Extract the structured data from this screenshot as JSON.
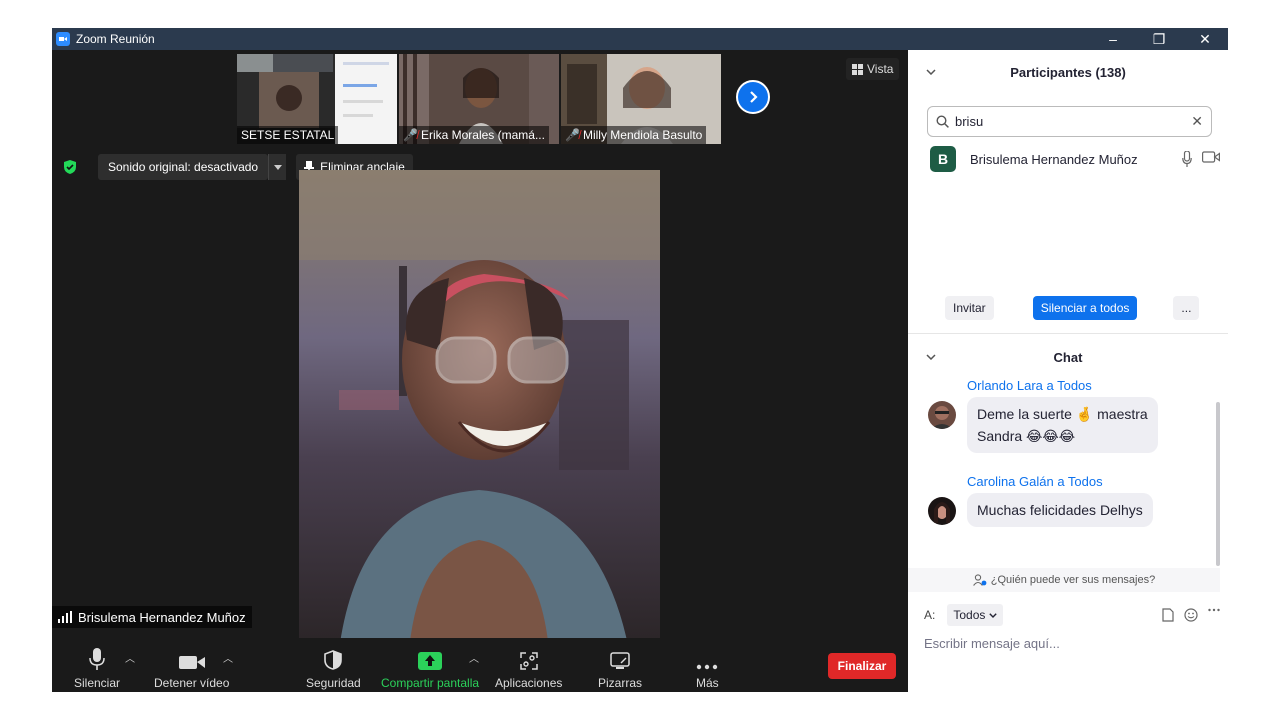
{
  "window": {
    "title": "Zoom Reunión",
    "controls": [
      "–",
      "❐",
      "✕"
    ]
  },
  "thumbnails": [
    {
      "name": "SETSE ESTATAL",
      "muted": false
    },
    {
      "name": "Erika Morales (mamá...",
      "muted": true
    },
    {
      "name": "Milly Mendiola Basulto",
      "muted": true
    }
  ],
  "view_button": "Vista",
  "original_sound": "Sonido original: desactivado",
  "unpin": "Eliminar anclaje",
  "speaker_name": "Brisulema Hernandez Muñoz",
  "toolbar": {
    "mute": "Silenciar",
    "stop_video": "Detener vídeo",
    "security": "Seguridad",
    "share": "Compartir pantalla",
    "apps": "Aplicaciones",
    "whiteboards": "Pizarras",
    "more": "Más",
    "end": "Finalizar"
  },
  "participants": {
    "title": "Participantes (138)",
    "search_value": "brisu",
    "list": [
      {
        "initial": "B",
        "name": "Brisulema Hernandez Muñoz"
      }
    ],
    "invite": "Invitar",
    "mute_all": "Silenciar a todos",
    "more": "..."
  },
  "chat": {
    "title": "Chat",
    "messages": [
      {
        "sender": "Orlando Lara a Todos",
        "text_line1": "Deme la suerte 🤞 maestra",
        "text_line2": "Sandra 😂😂😂"
      },
      {
        "sender": "Carolina Galán a Todos",
        "text_line1": "Muchas felicidades Delhys"
      }
    ],
    "who_can_see": "¿Quién puede ver sus mensajes?",
    "to_label": "A:",
    "to_value": "Todos",
    "input_placeholder": "Escribir mensaje aquí..."
  },
  "colors": {
    "accent": "#0e72ed",
    "end": "#e02828",
    "share": "#2bd15a",
    "titlebar": "#2b3a4e"
  }
}
